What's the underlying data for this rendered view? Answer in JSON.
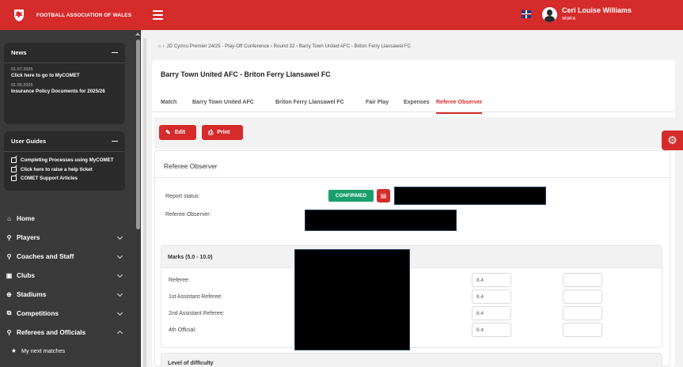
{
  "brand": {
    "name": "FOOTBALL ASSOCIATION OF WALES"
  },
  "sidebar": {
    "news": {
      "title": "News",
      "items": [
        {
          "date": "01.07.2025",
          "title": "Click here to go to MyCOMET"
        },
        {
          "date": "01.06.2025",
          "title": "Insurance Policy Documents for 2025/26"
        }
      ]
    },
    "guides": {
      "title": "User Guides",
      "items": [
        {
          "label": "Completing Processes using MyCOMET"
        },
        {
          "label": "Click here to raise a help ticket"
        },
        {
          "label": "COMET Support Articles"
        }
      ]
    },
    "nav": [
      {
        "label": "Home",
        "icon": "home-icon"
      },
      {
        "label": "Players",
        "icon": "players-icon"
      },
      {
        "label": "Coaches and Staff",
        "icon": "coaches-icon"
      },
      {
        "label": "Clubs",
        "icon": "clubs-icon"
      },
      {
        "label": "Stadiums",
        "icon": "stadiums-icon"
      },
      {
        "label": "Competitions",
        "icon": "competitions-icon"
      },
      {
        "label": "Referees and Officials",
        "icon": "referees-icon"
      },
      {
        "label": "My next matches",
        "icon": "star-icon"
      }
    ]
  },
  "topbar": {
    "user_name": "Ceri Louise Williams",
    "user_org": "WWFA"
  },
  "breadcrumb": "JD Cymru Premier 24/25 · Play-Off Conference › Round 32 › Barry Town United AFC - Briton Ferry Llansawel FC",
  "match": {
    "title": "Barry Town United AFC - Briton Ferry Llansawel FC",
    "tabs": [
      {
        "label": "Match"
      },
      {
        "label": "Barry Town United AFC"
      },
      {
        "label": "Briton Ferry Llansawel FC"
      },
      {
        "label": "Fair Play"
      },
      {
        "label": "Expenses"
      },
      {
        "label": "Referee Observer"
      }
    ]
  },
  "toolbar": {
    "edit_label": "Edit",
    "print_label": "Print"
  },
  "referee_observer": {
    "title": "Referee Observer",
    "report_status_label": "Report status:",
    "report_status": "CONFIRMED",
    "observer_label": "Referee Observer:",
    "marks_title": "Marks (5.0 - 10.0)",
    "marks": [
      {
        "label": "Referee:",
        "value": "8.4"
      },
      {
        "label": "1st Assistant Referee:",
        "value": "8.4"
      },
      {
        "label": "2nd Assistant Referee:",
        "value": "8.4"
      },
      {
        "label": "4th Official:",
        "value": "8.4"
      }
    ],
    "difficulty_title": "Level of difficulty"
  },
  "colors": {
    "brand_red": "#d62b2b",
    "confirmed_green": "#1aa06d",
    "sidebar_dark": "#3a3a3a"
  }
}
